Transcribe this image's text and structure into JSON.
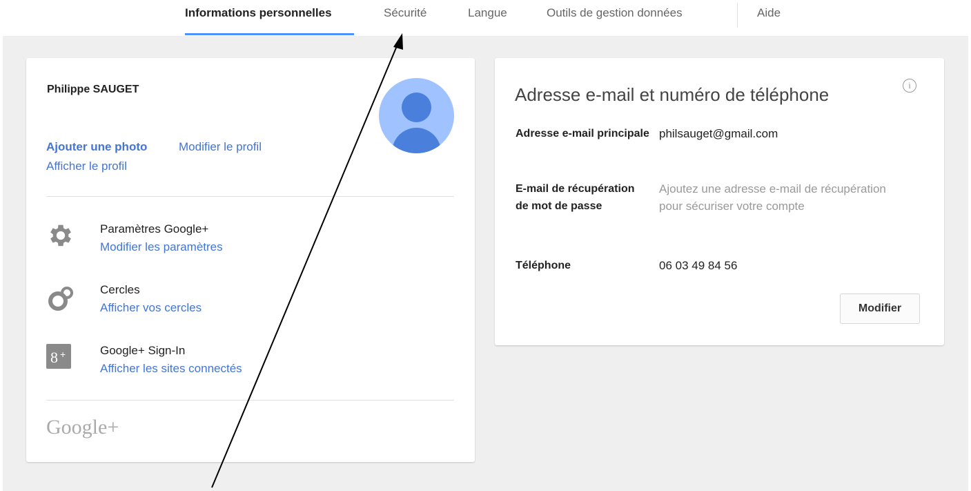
{
  "nav": {
    "tabs": [
      {
        "label": "Informations personnelles"
      },
      {
        "label": "Sécurité"
      },
      {
        "label": "Langue"
      },
      {
        "label": "Outils de gestion données"
      },
      {
        "label": "Aide"
      }
    ],
    "active_tab": "Informations personnelles"
  },
  "profile": {
    "name": "Philippe SAUGET",
    "add_photo": "Ajouter une photo",
    "edit_profile": "Modifier le profil",
    "view_profile": "Afficher le profil",
    "avatar_icon": "person-avatar-icon",
    "items": [
      {
        "icon": "gear-icon",
        "title": "Paramètres Google+",
        "link": "Modifier les paramètres"
      },
      {
        "icon": "circles-icon",
        "title": "Cercles",
        "link": "Afficher vos cercles"
      },
      {
        "icon": "google-plus-icon",
        "title": "Google+ Sign-In",
        "link": "Afficher les sites connectés"
      }
    ],
    "footer_logo": "Google+"
  },
  "contact": {
    "title": "Adresse e-mail et numéro de téléphone",
    "info_icon": "info-icon",
    "fields": [
      {
        "label": "Adresse e-mail principale",
        "value": "philsauget@gmail.com"
      },
      {
        "label": "E-mail de récupération de mot de passe",
        "value": "Ajoutez une adresse e-mail de récupération pour sécuriser votre compte"
      },
      {
        "label": "Téléphone",
        "value": "06 03 49 84 56"
      }
    ],
    "edit_button": "Modifier"
  },
  "colors": {
    "accent": "#4d90fe",
    "link": "#4275d4",
    "background": "#efefef",
    "avatar": "#a0c3ff"
  }
}
